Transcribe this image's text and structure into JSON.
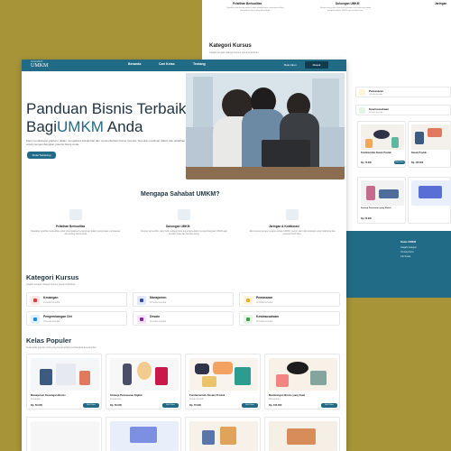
{
  "brand": {
    "top": "SAHABAT",
    "main": "UMKM"
  },
  "nav": {
    "links": [
      "Beranda",
      "Cari Kelas",
      "Tentang"
    ],
    "login": "Buat Akun",
    "register": "Masuk"
  },
  "hero": {
    "title_line1": "Panduan Bisnis Terbaik",
    "title_line2_prefix": "Bagi",
    "title_highlight": "UMKM",
    "title_line2_suffix": " Anda",
    "description": "Kami membangun platform dalam mengakses kebutuhan dan menumbuhkan bisnis mereka. Temukan panduan dalam dan pelatihan untuk mengembangkan potensi bisnis Anda.",
    "cta": "Mulai Sekarang"
  },
  "why": {
    "title": "Mengapa Sahabat UMKM?",
    "items": [
      {
        "title": "Pelatihan Berkualitas",
        "text": "Dapatkan pelatihan berkualitas untuk meningkatkan kemampuan dalam pengelolaan, pemasaran, dan strategi bisnis Anda."
      },
      {
        "title": "Dukungan UMKM",
        "text": "Dengan semua fitur, kami hadir sebagai mitra terpercaya dalam mengembangkan UMKM agar semakin maju dan berdaya saing."
      },
      {
        "title": "Jaringan & Kolaborasi",
        "text": "Jalin koneksi dengan sesama pelaku UMKM, mentor, dan mitra strategis untuk kolaborasi dan peluang bisnis baru."
      }
    ]
  },
  "categories": {
    "title": "Kategori Kursus",
    "subtitle": "Jelajahi beragam kategori kursus sesuai kebutuhan",
    "items": [
      {
        "name": "Keuangan",
        "count": "10 kelas tersedia",
        "color": "#e53935",
        "bg": "#fde6e6"
      },
      {
        "name": "Manajemen",
        "count": "10 kelas tersedia",
        "color": "#3949ab",
        "bg": "#e3e7fb"
      },
      {
        "name": "Pemasaran",
        "count": "10 kelas tersedia",
        "color": "#f9a825",
        "bg": "#fff5d6"
      },
      {
        "name": "Pengembangan Diri",
        "count": "10 kelas tersedia",
        "color": "#1e88e5",
        "bg": "#e1f0fd"
      },
      {
        "name": "Desain",
        "count": "10 kelas tersedia",
        "color": "#8e24aa",
        "bg": "#f3e3f8"
      },
      {
        "name": "Kewirausahaan",
        "count": "10 kelas tersedia",
        "color": "#43a047",
        "bg": "#e4f4e5"
      }
    ]
  },
  "popular": {
    "title": "Kelas Populer",
    "subtitle": "Kelas-kelas populer untuk yang menginginkan kembangkan keterampilan",
    "courses": [
      {
        "title": "Manajemen Keuangan Bisnis",
        "category": "Keuangan",
        "price": "Rp. 50.000",
        "button": "Beli Kelas"
      },
      {
        "title": "Strategi Pemasaran Digital",
        "category": "Pemasaran",
        "price": "Rp. 50.000",
        "button": "Beli Kelas"
      },
      {
        "title": "Fundamentals Desain Produk",
        "category": "Desain Produk",
        "price": "Rp. 70.000",
        "button": "Beli Kelas"
      },
      {
        "title": "Membangun Bisnis yang Kuat",
        "category": "Manajemen",
        "price": "Rp. 100.000",
        "button": "Beli Kelas"
      }
    ]
  },
  "back": {
    "features": [
      {
        "title": "Pelatihan Berkualitas",
        "text": "Dapatkan pelatihan berkualitas untuk meningkatkan kemampuan dalam pengelolaan dan strategi bisnis Anda."
      },
      {
        "title": "Dukungan UMKM",
        "text": "Dengan semua fitur, kami hadir sebagai mitra terpercaya dalam mengembangkan UMKM agar semakin maju."
      },
      {
        "title": "Jaringan",
        "text": ""
      }
    ],
    "category_title": "Kategori Kursus",
    "category_subtitle": "Jelajahi beragam kategori kursus sesuai kebutuhan",
    "side_categories": [
      {
        "name": "Pemasaran",
        "count": "10 kelas tersedia"
      },
      {
        "name": "Kewirausahaan",
        "count": "10 kelas tersedia"
      }
    ],
    "course_a": "Fundamentals Desain Produk",
    "course_b": "Desain Produk",
    "price_a": "Rp. 70.000",
    "price_b": "Rp. 100.000",
    "button": "Beli Kelas",
    "course_c": "Strategi Pemasaran yang Efektif",
    "price_c": "Rp. 50.000",
    "footer_heading": "Kelas UMKM",
    "footer_links": [
      "Jelajahi Kategori",
      "Tentang Kami",
      "Cari Kelas"
    ]
  }
}
